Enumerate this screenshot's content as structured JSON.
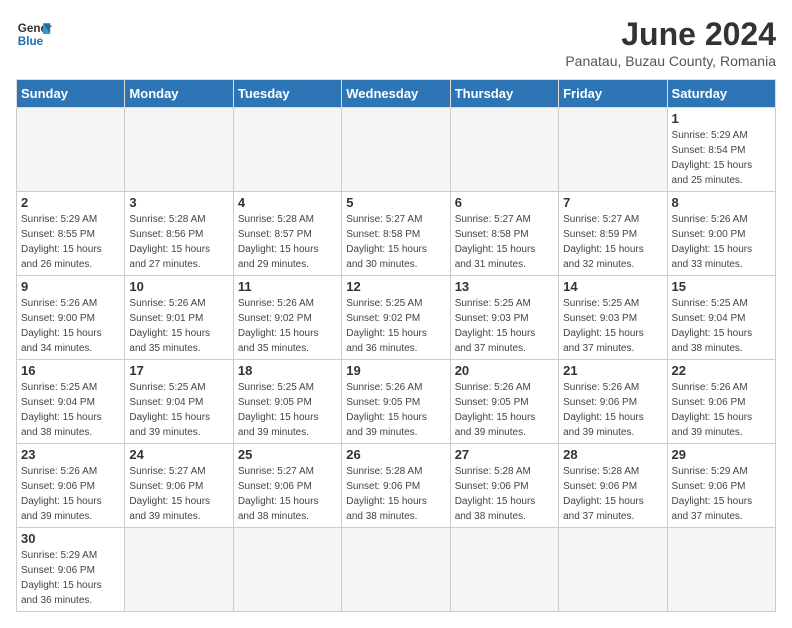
{
  "logo": {
    "text_general": "General",
    "text_blue": "Blue"
  },
  "header": {
    "title": "June 2024",
    "subtitle": "Panatau, Buzau County, Romania"
  },
  "weekdays": [
    "Sunday",
    "Monday",
    "Tuesday",
    "Wednesday",
    "Thursday",
    "Friday",
    "Saturday"
  ],
  "weeks": [
    [
      {
        "day": "",
        "info": ""
      },
      {
        "day": "",
        "info": ""
      },
      {
        "day": "",
        "info": ""
      },
      {
        "day": "",
        "info": ""
      },
      {
        "day": "",
        "info": ""
      },
      {
        "day": "",
        "info": ""
      },
      {
        "day": "1",
        "info": "Sunrise: 5:29 AM\nSunset: 8:54 PM\nDaylight: 15 hours\nand 25 minutes."
      }
    ],
    [
      {
        "day": "2",
        "info": "Sunrise: 5:29 AM\nSunset: 8:55 PM\nDaylight: 15 hours\nand 26 minutes."
      },
      {
        "day": "3",
        "info": "Sunrise: 5:28 AM\nSunset: 8:56 PM\nDaylight: 15 hours\nand 27 minutes."
      },
      {
        "day": "4",
        "info": "Sunrise: 5:28 AM\nSunset: 8:57 PM\nDaylight: 15 hours\nand 29 minutes."
      },
      {
        "day": "5",
        "info": "Sunrise: 5:27 AM\nSunset: 8:58 PM\nDaylight: 15 hours\nand 30 minutes."
      },
      {
        "day": "6",
        "info": "Sunrise: 5:27 AM\nSunset: 8:58 PM\nDaylight: 15 hours\nand 31 minutes."
      },
      {
        "day": "7",
        "info": "Sunrise: 5:27 AM\nSunset: 8:59 PM\nDaylight: 15 hours\nand 32 minutes."
      },
      {
        "day": "8",
        "info": "Sunrise: 5:26 AM\nSunset: 9:00 PM\nDaylight: 15 hours\nand 33 minutes."
      }
    ],
    [
      {
        "day": "9",
        "info": "Sunrise: 5:26 AM\nSunset: 9:00 PM\nDaylight: 15 hours\nand 34 minutes."
      },
      {
        "day": "10",
        "info": "Sunrise: 5:26 AM\nSunset: 9:01 PM\nDaylight: 15 hours\nand 35 minutes."
      },
      {
        "day": "11",
        "info": "Sunrise: 5:26 AM\nSunset: 9:02 PM\nDaylight: 15 hours\nand 35 minutes."
      },
      {
        "day": "12",
        "info": "Sunrise: 5:25 AM\nSunset: 9:02 PM\nDaylight: 15 hours\nand 36 minutes."
      },
      {
        "day": "13",
        "info": "Sunrise: 5:25 AM\nSunset: 9:03 PM\nDaylight: 15 hours\nand 37 minutes."
      },
      {
        "day": "14",
        "info": "Sunrise: 5:25 AM\nSunset: 9:03 PM\nDaylight: 15 hours\nand 37 minutes."
      },
      {
        "day": "15",
        "info": "Sunrise: 5:25 AM\nSunset: 9:04 PM\nDaylight: 15 hours\nand 38 minutes."
      }
    ],
    [
      {
        "day": "16",
        "info": "Sunrise: 5:25 AM\nSunset: 9:04 PM\nDaylight: 15 hours\nand 38 minutes."
      },
      {
        "day": "17",
        "info": "Sunrise: 5:25 AM\nSunset: 9:04 PM\nDaylight: 15 hours\nand 39 minutes."
      },
      {
        "day": "18",
        "info": "Sunrise: 5:25 AM\nSunset: 9:05 PM\nDaylight: 15 hours\nand 39 minutes."
      },
      {
        "day": "19",
        "info": "Sunrise: 5:26 AM\nSunset: 9:05 PM\nDaylight: 15 hours\nand 39 minutes."
      },
      {
        "day": "20",
        "info": "Sunrise: 5:26 AM\nSunset: 9:05 PM\nDaylight: 15 hours\nand 39 minutes."
      },
      {
        "day": "21",
        "info": "Sunrise: 5:26 AM\nSunset: 9:06 PM\nDaylight: 15 hours\nand 39 minutes."
      },
      {
        "day": "22",
        "info": "Sunrise: 5:26 AM\nSunset: 9:06 PM\nDaylight: 15 hours\nand 39 minutes."
      }
    ],
    [
      {
        "day": "23",
        "info": "Sunrise: 5:26 AM\nSunset: 9:06 PM\nDaylight: 15 hours\nand 39 minutes."
      },
      {
        "day": "24",
        "info": "Sunrise: 5:27 AM\nSunset: 9:06 PM\nDaylight: 15 hours\nand 39 minutes."
      },
      {
        "day": "25",
        "info": "Sunrise: 5:27 AM\nSunset: 9:06 PM\nDaylight: 15 hours\nand 38 minutes."
      },
      {
        "day": "26",
        "info": "Sunrise: 5:28 AM\nSunset: 9:06 PM\nDaylight: 15 hours\nand 38 minutes."
      },
      {
        "day": "27",
        "info": "Sunrise: 5:28 AM\nSunset: 9:06 PM\nDaylight: 15 hours\nand 38 minutes."
      },
      {
        "day": "28",
        "info": "Sunrise: 5:28 AM\nSunset: 9:06 PM\nDaylight: 15 hours\nand 37 minutes."
      },
      {
        "day": "29",
        "info": "Sunrise: 5:29 AM\nSunset: 9:06 PM\nDaylight: 15 hours\nand 37 minutes."
      }
    ],
    [
      {
        "day": "30",
        "info": "Sunrise: 5:29 AM\nSunset: 9:06 PM\nDaylight: 15 hours\nand 36 minutes."
      },
      {
        "day": "",
        "info": ""
      },
      {
        "day": "",
        "info": ""
      },
      {
        "day": "",
        "info": ""
      },
      {
        "day": "",
        "info": ""
      },
      {
        "day": "",
        "info": ""
      },
      {
        "day": "",
        "info": ""
      }
    ]
  ]
}
